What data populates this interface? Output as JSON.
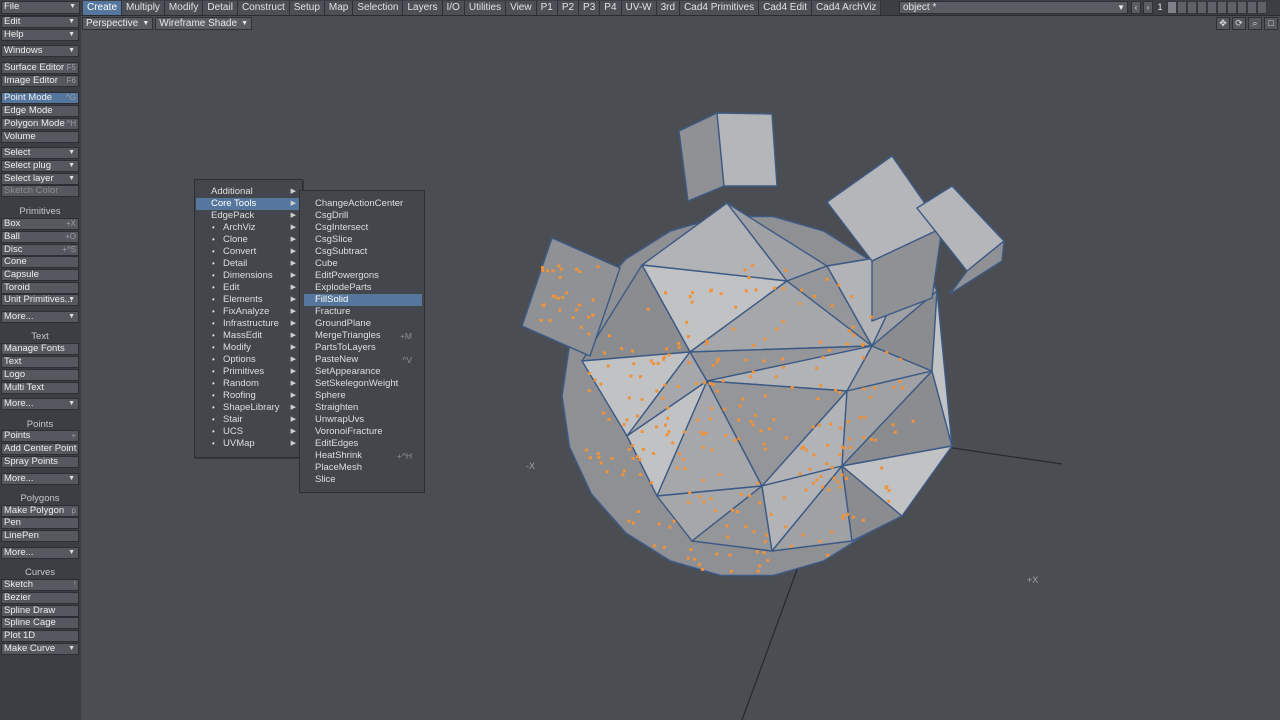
{
  "topbar": {
    "file_label": "File",
    "tabs": [
      "Create",
      "Multiply",
      "Modify",
      "Detail",
      "Construct",
      "Setup",
      "Map",
      "Selection",
      "Layers",
      "I/O",
      "Utilities",
      "View",
      "P1",
      "P2",
      "P3",
      "P4",
      "UV-W",
      "3rd",
      "Cad4 Primitives",
      "Cad4 Edit",
      "Cad4 ArchViz"
    ],
    "active_tab": "Create",
    "object_select": "object *",
    "layer_number": "1"
  },
  "sidebar": {
    "items": [
      {
        "label": "Edit",
        "dropdown": true
      },
      {
        "label": "Help",
        "dropdown": true
      },
      {
        "label": "Windows",
        "dropdown": true
      },
      {
        "label": "Surface Editor",
        "shortcut": "F5"
      },
      {
        "label": "Image Editor",
        "shortcut": "F6"
      },
      {
        "label": "Point Mode",
        "shortcut": "^G",
        "active": true
      },
      {
        "label": "Edge Mode"
      },
      {
        "label": "Polygon Mode",
        "shortcut": "^H"
      },
      {
        "label": "Volume"
      },
      {
        "label": "Select",
        "dropdown": true
      },
      {
        "label": "Select plug",
        "dropdown": true
      },
      {
        "label": "Select layer",
        "dropdown": true
      },
      {
        "label": "Sketch Color",
        "disabled": true
      }
    ],
    "sections": {
      "primitives": {
        "header": "Primitives",
        "items": [
          {
            "label": "Box",
            "shortcut": "+X"
          },
          {
            "label": "Ball",
            "shortcut": "+O"
          },
          {
            "label": "Disc",
            "shortcut": "+^S"
          },
          {
            "label": "Cone"
          },
          {
            "label": "Capsule"
          },
          {
            "label": "Toroid"
          },
          {
            "label": "Unit Primitives...",
            "dropdown": true
          },
          {
            "label": "More...",
            "dropdown": true
          }
        ]
      },
      "text": {
        "header": "Text",
        "items": [
          {
            "label": "Manage Fonts"
          },
          {
            "label": "Text"
          },
          {
            "label": "Logo"
          },
          {
            "label": "Multi Text"
          },
          {
            "label": "More...",
            "dropdown": true
          }
        ]
      },
      "points": {
        "header": "Points",
        "items": [
          {
            "label": "Points",
            "shortcut": "+"
          },
          {
            "label": "Add Center Point"
          },
          {
            "label": "Spray Points"
          },
          {
            "label": "More...",
            "dropdown": true
          }
        ]
      },
      "polygons": {
        "header": "Polygons",
        "items": [
          {
            "label": "Make Polygon",
            "shortcut": "p"
          },
          {
            "label": "Pen"
          },
          {
            "label": "LinePen"
          },
          {
            "label": "More...",
            "dropdown": true
          }
        ]
      },
      "curves": {
        "header": "Curves",
        "items": [
          {
            "label": "Sketch",
            "shortcut": "!"
          },
          {
            "label": "Bezier"
          },
          {
            "label": "Spline Draw"
          },
          {
            "label": "Spline Cage"
          },
          {
            "label": "Plot 1D"
          },
          {
            "label": "Make Curve",
            "dropdown": true
          }
        ]
      }
    }
  },
  "viewport": {
    "view_type": "Perspective",
    "shading": "Wireframe Shade",
    "axis_labels": [
      "-X",
      "+X"
    ],
    "colors": {
      "background": "#4a4e53",
      "mesh_fill": "#a7a9ab",
      "mesh_edge": "#3d5a85",
      "points": "#f0923a"
    }
  },
  "menu_primary": {
    "items": [
      {
        "label": "Additional",
        "submenu": true
      },
      {
        "label": "Core Tools",
        "submenu": true,
        "highlighted": true
      },
      {
        "label": "EdgePack",
        "submenu": true
      },
      {
        "label": "ArchViz",
        "bullet": true,
        "submenu": true
      },
      {
        "label": "Clone",
        "bullet": true,
        "submenu": true
      },
      {
        "label": "Convert",
        "bullet": true,
        "submenu": true
      },
      {
        "label": "Detail",
        "bullet": true,
        "submenu": true
      },
      {
        "label": "Dimensions",
        "bullet": true,
        "submenu": true
      },
      {
        "label": "Edit",
        "bullet": true,
        "submenu": true
      },
      {
        "label": "Elements",
        "bullet": true,
        "submenu": true
      },
      {
        "label": "FixAnalyze",
        "bullet": true,
        "submenu": true
      },
      {
        "label": "Infrastructure",
        "bullet": true,
        "submenu": true
      },
      {
        "label": "MassEdit",
        "bullet": true,
        "submenu": true
      },
      {
        "label": "Modify",
        "bullet": true,
        "submenu": true
      },
      {
        "label": "Options",
        "bullet": true,
        "submenu": true
      },
      {
        "label": "Primitives",
        "bullet": true,
        "submenu": true
      },
      {
        "label": "Random",
        "bullet": true,
        "submenu": true
      },
      {
        "label": "Roofing",
        "bullet": true,
        "submenu": true
      },
      {
        "label": "ShapeLibrary",
        "bullet": true,
        "submenu": true
      },
      {
        "label": "Stair",
        "bullet": true,
        "submenu": true
      },
      {
        "label": "UCS",
        "bullet": true,
        "submenu": true
      },
      {
        "label": "UVMap",
        "bullet": true,
        "submenu": true
      }
    ]
  },
  "menu_core_tools": {
    "items": [
      {
        "label": "ChangeActionCenter"
      },
      {
        "label": "CsgDrill"
      },
      {
        "label": "CsgIntersect"
      },
      {
        "label": "CsgSlice"
      },
      {
        "label": "CsgSubtract"
      },
      {
        "label": "Cube"
      },
      {
        "label": "EditPowergons"
      },
      {
        "label": "ExplodeParts"
      },
      {
        "label": "FillSolid",
        "highlighted": true
      },
      {
        "label": "Fracture"
      },
      {
        "label": "GroundPlane"
      },
      {
        "label": "MergeTriangles",
        "shortcut": "+M"
      },
      {
        "label": "PartsToLayers"
      },
      {
        "label": "PasteNew",
        "shortcut": "^V"
      },
      {
        "label": "SetAppearance"
      },
      {
        "label": "SetSkelegonWeight"
      },
      {
        "label": "Sphere"
      },
      {
        "label": "Straighten"
      },
      {
        "label": "UnwrapUvs"
      },
      {
        "label": "VoronoiFracture"
      },
      {
        "label": "EditEdges"
      },
      {
        "label": "HeatShrink",
        "shortcut": "+^H"
      },
      {
        "label": "PlaceMesh"
      },
      {
        "label": "Slice"
      }
    ]
  }
}
